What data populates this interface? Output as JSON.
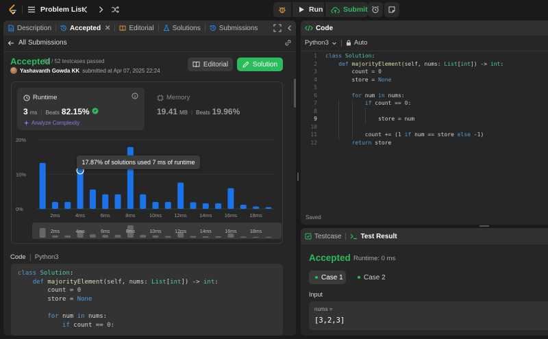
{
  "topbar": {
    "problem_list": "Problem List",
    "run_label": "Run",
    "submit_label": "Submit"
  },
  "tabs": {
    "description": "Description",
    "accepted": "Accepted",
    "editorial": "Editorial",
    "solutions": "Solutions",
    "submissions": "Submissions"
  },
  "submission": {
    "back_label": "All Submissions",
    "status": "Accepted",
    "testcases": "52 / 52 testcases passed",
    "username": "Yashavanth Gowda KK",
    "submitted_at": "submitted at Apr 07, 2025 22:24",
    "editorial_button": "Editorial",
    "solution_button": "Solution"
  },
  "runtime": {
    "title": "Runtime",
    "value": "3",
    "unit": "ms",
    "beats_label": "Beats",
    "beats": "82.15%",
    "analyze": "Analyze Complexity"
  },
  "memory": {
    "title": "Memory",
    "value": "19.41",
    "unit": "MB",
    "beats_label": "Beats",
    "beats": "19.96%"
  },
  "chart_data": {
    "type": "bar",
    "title": "",
    "xlabel": "",
    "ylabel": "",
    "ylim": [
      0,
      20
    ],
    "y_ticks": [
      "0%",
      "10%",
      "20%"
    ],
    "x_ticks": [
      "2ms",
      "4ms",
      "6ms",
      "8ms",
      "10ms",
      "12ms",
      "14ms",
      "16ms",
      "18ms"
    ],
    "values": [
      13.3,
      2.0,
      2.0,
      11.5,
      5.6,
      4.2,
      4.2,
      17.87,
      4.2,
      2.0,
      2.0,
      7.6,
      1.9,
      1.6,
      1.6,
      6.0,
      1.2,
      0.7,
      0.5
    ],
    "highlight_index": 3,
    "overview_values": [
      3.5,
      0.8,
      0.8,
      2.5,
      1.2,
      1.0,
      1.0,
      4.5,
      1.0,
      0.8,
      0.6,
      2.0,
      0.6,
      0.5,
      0.5,
      1.5,
      0.4,
      0.3,
      0.3
    ],
    "tooltip": "17.87% of solutions used 7 ms of runtime"
  },
  "code_section": {
    "label": "Code",
    "language": "Python3",
    "lines": [
      "class Solution:",
      "    def majorityElement(self, nums: List[int]) -> int:",
      "        count = 0",
      "        store = None",
      "",
      "        for num in nums:",
      "            if count == 0:"
    ]
  },
  "editor": {
    "title": "Code",
    "language": "Python3",
    "mode": "Auto",
    "saved": "Saved",
    "lines": [
      "class Solution:",
      "    def majorityElement(self, nums: List[int]) -> int:",
      "        count = 0",
      "        store = None",
      "",
      "        for num in nums:",
      "            if count == 0:",
      "",
      "                store = num",
      "",
      "            count += (1 if num == store else -1)",
      "        return store"
    ],
    "line_numbers": [
      "1",
      "2",
      "3",
      "4",
      "5",
      "6",
      "7",
      "8",
      "9",
      "10",
      "11",
      "12"
    ]
  },
  "result": {
    "testcase_tab": "Testcase",
    "result_tab": "Test Result",
    "status": "Accepted",
    "runtime": "Runtime: 0 ms",
    "case1": "Case 1",
    "case2": "Case 2",
    "input_label": "Input",
    "input_name": "nums =",
    "input_value": "[3,2,3]"
  },
  "colors": {
    "accent_green": "#2cbb5d",
    "bar_blue": "#1a73e8",
    "analyze_purple": "#8a7cf0"
  }
}
